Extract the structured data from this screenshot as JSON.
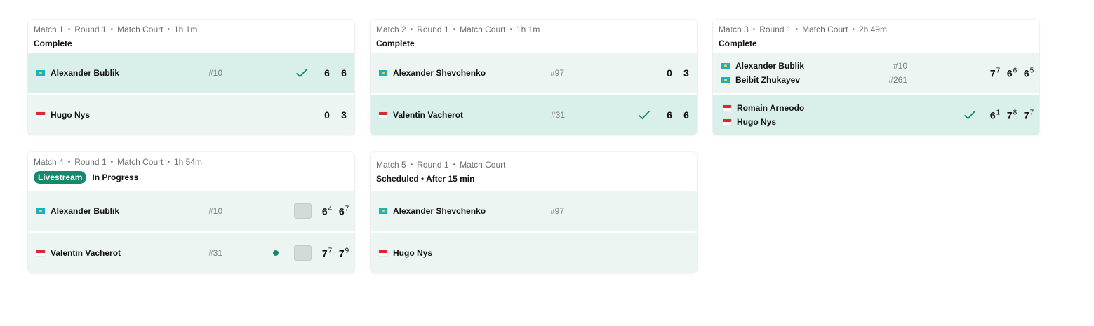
{
  "colors": {
    "accent": "#17876e",
    "win_row": "#d9efea",
    "row": "#edf5f3"
  },
  "matches": [
    {
      "meta": [
        "Match 1",
        "Round 1",
        "Match Court",
        "1h 1m"
      ],
      "status": "Complete",
      "rows": [
        {
          "players": [
            {
              "flag": "kz",
              "name": "Alexander Bublik"
            }
          ],
          "seeds": [
            "#10"
          ],
          "winner": true,
          "scores": [
            {
              "v": "6"
            },
            {
              "v": "6"
            }
          ]
        },
        {
          "players": [
            {
              "flag": "mc",
              "name": "Hugo Nys"
            }
          ],
          "seeds": [],
          "winner": false,
          "scores": [
            {
              "v": "0"
            },
            {
              "v": "3"
            }
          ]
        }
      ]
    },
    {
      "meta": [
        "Match 2",
        "Round 1",
        "Match Court",
        "1h 1m"
      ],
      "status": "Complete",
      "rows": [
        {
          "players": [
            {
              "flag": "kz",
              "name": "Alexander Shevchenko"
            }
          ],
          "seeds": [
            "#97"
          ],
          "winner": false,
          "scores": [
            {
              "v": "0"
            },
            {
              "v": "3"
            }
          ]
        },
        {
          "players": [
            {
              "flag": "mc",
              "name": "Valentin Vacherot"
            }
          ],
          "seeds": [
            "#31"
          ],
          "winner": true,
          "scores": [
            {
              "v": "6"
            },
            {
              "v": "6"
            }
          ]
        }
      ]
    },
    {
      "meta": [
        "Match 3",
        "Round 1",
        "Match Court",
        "2h 49m"
      ],
      "status": "Complete",
      "rows": [
        {
          "players": [
            {
              "flag": "kz",
              "name": "Alexander Bublik"
            },
            {
              "flag": "kz",
              "name": "Beibit Zhukayev"
            }
          ],
          "seeds": [
            "#10",
            "#261"
          ],
          "winner": false,
          "scores": [
            {
              "v": "7",
              "t": "7"
            },
            {
              "v": "6",
              "t": "6"
            },
            {
              "v": "6",
              "t": "5"
            }
          ]
        },
        {
          "players": [
            {
              "flag": "mc",
              "name": "Romain Arneodo"
            },
            {
              "flag": "mc",
              "name": "Hugo Nys"
            }
          ],
          "seeds": [],
          "winner": true,
          "scores": [
            {
              "v": "6",
              "t": "1"
            },
            {
              "v": "7",
              "t": "8"
            },
            {
              "v": "7",
              "t": "7"
            }
          ]
        }
      ]
    },
    {
      "meta": [
        "Match 4",
        "Round 1",
        "Match Court",
        "1h 54m"
      ],
      "status": "In Progress",
      "badge": "Livestream",
      "rows": [
        {
          "players": [
            {
              "flag": "kz",
              "name": "Alexander Bublik"
            }
          ],
          "seeds": [
            "#10"
          ],
          "winner": false,
          "scores": [
            {
              "v": "6",
              "t": "4"
            },
            {
              "v": "6",
              "t": "7"
            }
          ]
        },
        {
          "players": [
            {
              "flag": "mc",
              "name": "Valentin Vacherot"
            }
          ],
          "seeds": [
            "#31"
          ],
          "winner": false,
          "serving": true,
          "scores": [
            {
              "v": "7",
              "t": "7"
            },
            {
              "v": "7",
              "t": "9"
            }
          ]
        }
      ]
    },
    {
      "meta": [
        "Match 5",
        "Round 1",
        "Match Court"
      ],
      "status": "Scheduled • After 15 min",
      "rows": [
        {
          "players": [
            {
              "flag": "kz",
              "name": "Alexander Shevchenko"
            }
          ],
          "seeds": [
            "#97"
          ],
          "winner": false,
          "scores": []
        },
        {
          "players": [
            {
              "flag": "mc",
              "name": "Hugo Nys"
            }
          ],
          "seeds": [],
          "winner": false,
          "scores": []
        }
      ]
    }
  ]
}
